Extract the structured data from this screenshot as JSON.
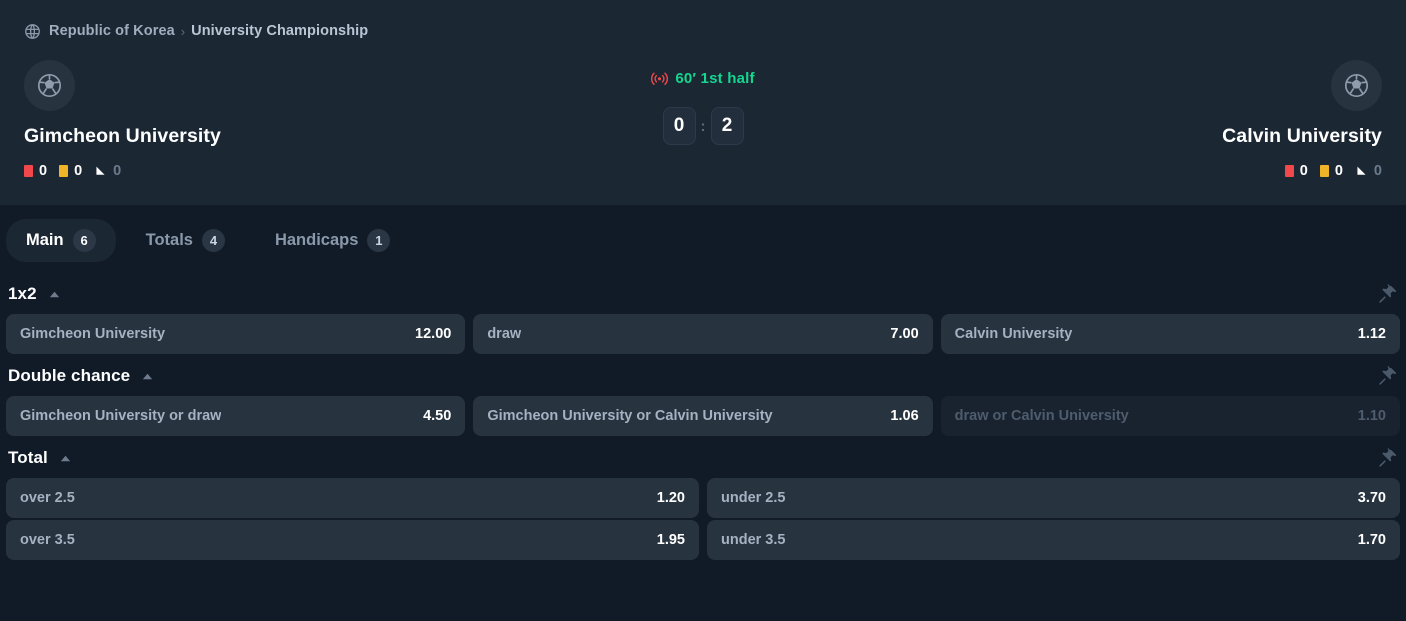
{
  "breadcrumb": {
    "icon": "globe-icon",
    "country": "Republic of Korea",
    "separator": "›",
    "league": "University Championship"
  },
  "match": {
    "home": {
      "name": "Gimcheon University",
      "avatar_icon": "soccer-ball-icon",
      "stats": [
        {
          "icon": "red-card-icon",
          "value": "0",
          "muted": false
        },
        {
          "icon": "yellow-card-icon",
          "value": "0",
          "muted": false
        },
        {
          "icon": "corner-flag-icon",
          "value": "0",
          "muted": true
        }
      ]
    },
    "away": {
      "name": "Calvin University",
      "avatar_icon": "soccer-ball-icon",
      "stats": [
        {
          "icon": "red-card-icon",
          "value": "0",
          "muted": false
        },
        {
          "icon": "yellow-card-icon",
          "value": "0",
          "muted": false
        },
        {
          "icon": "corner-flag-icon",
          "value": "0",
          "muted": true
        }
      ]
    },
    "status": {
      "icon": "live-broadcast-icon",
      "text": "60′ 1st half",
      "color": "#13d68f"
    },
    "score": {
      "home": "0",
      "separator": ":",
      "away": "2"
    }
  },
  "tabs": [
    {
      "label": "Main",
      "count": "6",
      "active": true
    },
    {
      "label": "Totals",
      "count": "4",
      "active": false
    },
    {
      "label": "Handicaps",
      "count": "1",
      "active": false
    }
  ],
  "markets": [
    {
      "title": "1x2",
      "collapse_icon": "caret-up-icon",
      "pin_icon": "pin-icon",
      "columns": 3,
      "rows": [
        [
          {
            "label": "Gimcheon University",
            "value": "12.00",
            "disabled": false
          },
          {
            "label": "draw",
            "value": "7.00",
            "disabled": false
          },
          {
            "label": "Calvin University",
            "value": "1.12",
            "disabled": false
          }
        ]
      ]
    },
    {
      "title": "Double chance",
      "collapse_icon": "caret-up-icon",
      "pin_icon": "pin-icon",
      "columns": 3,
      "rows": [
        [
          {
            "label": "Gimcheon University or draw",
            "value": "4.50",
            "disabled": false
          },
          {
            "label": "Gimcheon University or Calvin University",
            "value": "1.06",
            "disabled": false
          },
          {
            "label": "draw or Calvin University",
            "value": "1.10",
            "disabled": true
          }
        ]
      ]
    },
    {
      "title": "Total",
      "collapse_icon": "caret-up-icon",
      "pin_icon": "pin-icon",
      "columns": 2,
      "rows": [
        [
          {
            "label": "over 2.5",
            "value": "1.20",
            "disabled": false
          },
          {
            "label": "under 2.5",
            "value": "3.70",
            "disabled": false
          }
        ],
        [
          {
            "label": "over 3.5",
            "value": "1.95",
            "disabled": false
          },
          {
            "label": "under 3.5",
            "value": "1.70",
            "disabled": false
          }
        ]
      ]
    }
  ],
  "colors": {
    "page_bg": "#111b27",
    "card_bg": "#1c2734",
    "odds_bg": "#27333f",
    "odds_disabled_bg": "#192330",
    "live_green": "#13d68f",
    "red_card": "#f2484b",
    "yellow_card": "#f0b429"
  }
}
